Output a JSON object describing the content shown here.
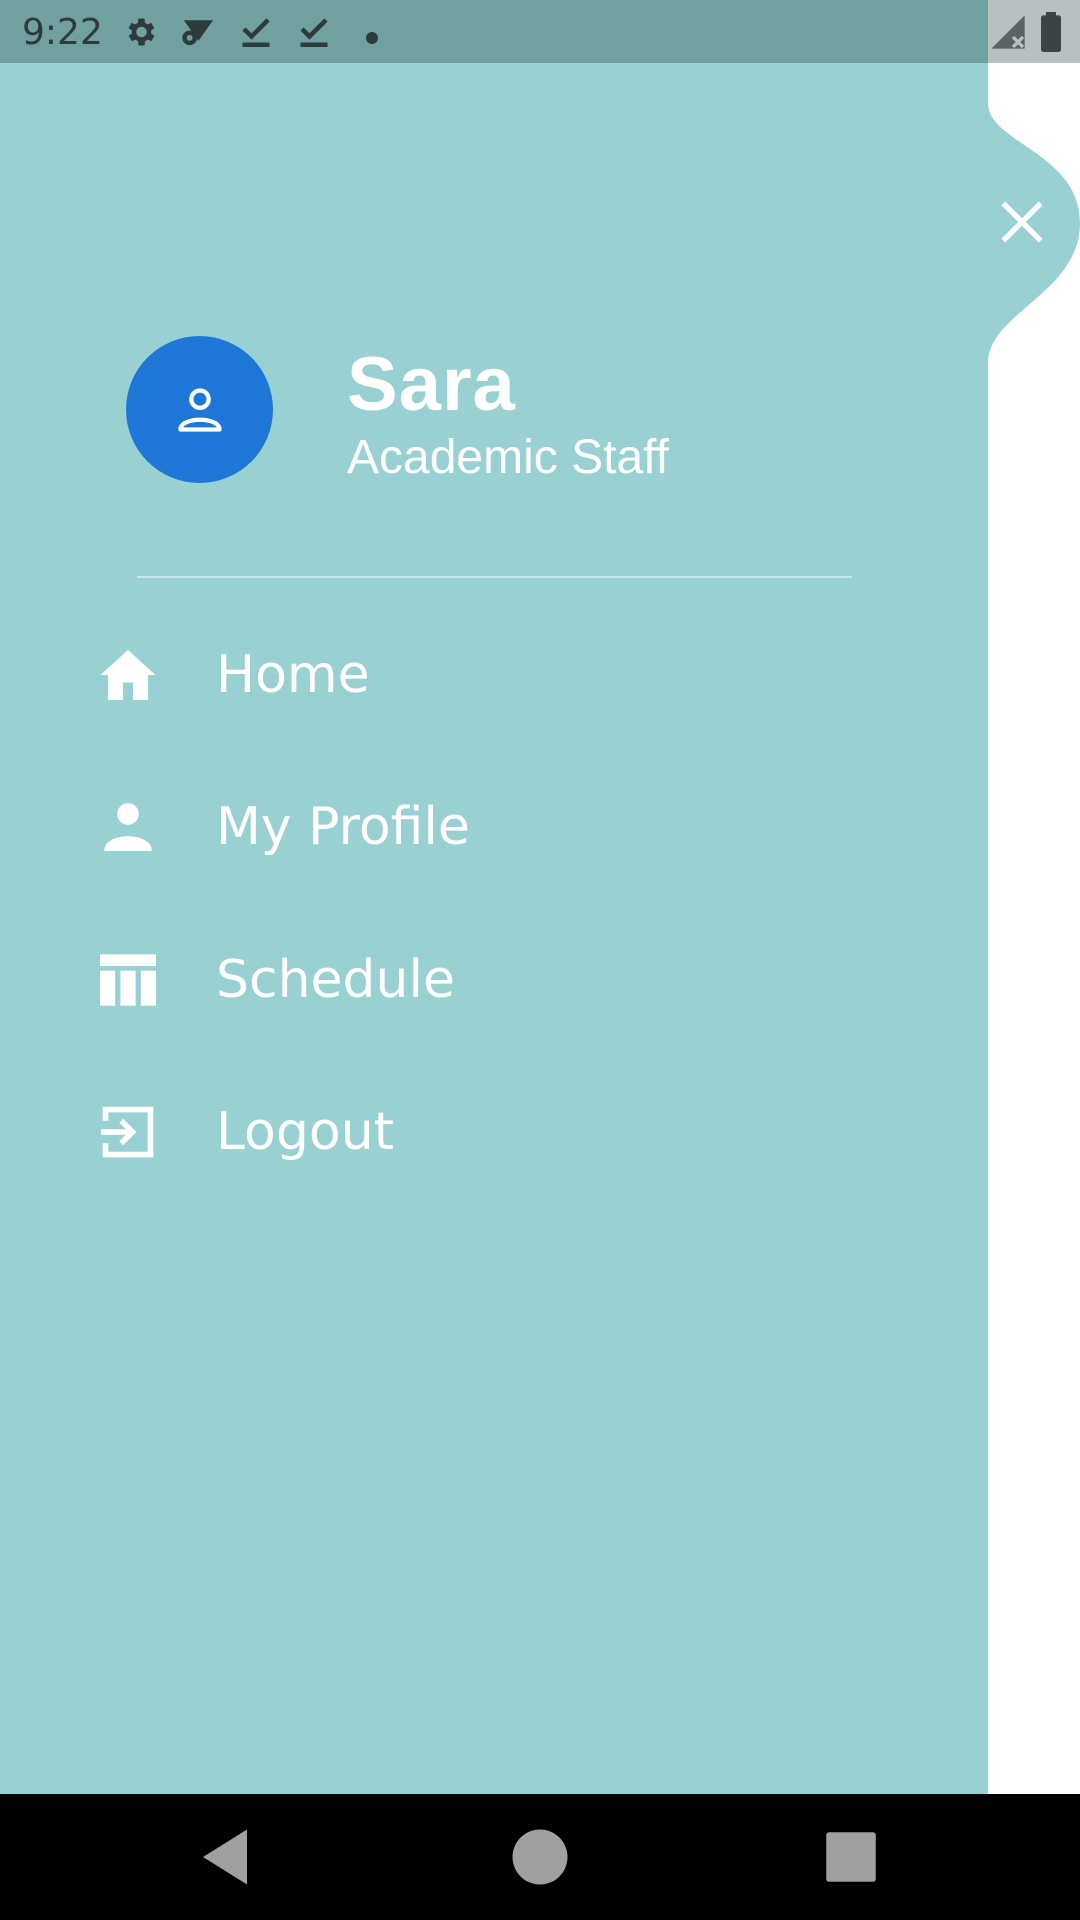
{
  "status_bar": {
    "time": "9:22",
    "icons": [
      "gear-icon",
      "wifi-gear-icon",
      "check-download-icon",
      "check-download-icon",
      "dot-icon",
      "signal-off-icon",
      "battery-icon"
    ]
  },
  "drawer": {
    "user": {
      "name": "Sara",
      "role": "Academic Staff",
      "avatar_icon": "person-outline-icon"
    },
    "menu": [
      {
        "label": "Home",
        "icon": "home-icon"
      },
      {
        "label": "My Profile",
        "icon": "person-icon"
      },
      {
        "label": "Schedule",
        "icon": "schedule-table-icon"
      },
      {
        "label": "Logout",
        "icon": "logout-icon"
      }
    ],
    "close_icon": "close-icon"
  },
  "nav_bar": {
    "buttons": [
      "back-icon",
      "home-circle-icon",
      "recents-square-icon"
    ]
  },
  "colors": {
    "drawer_bg": "#99d1d3",
    "status_bar_bg": "#70a0a0",
    "avatar_bg": "#1e77d6",
    "text": "#ffffff"
  }
}
